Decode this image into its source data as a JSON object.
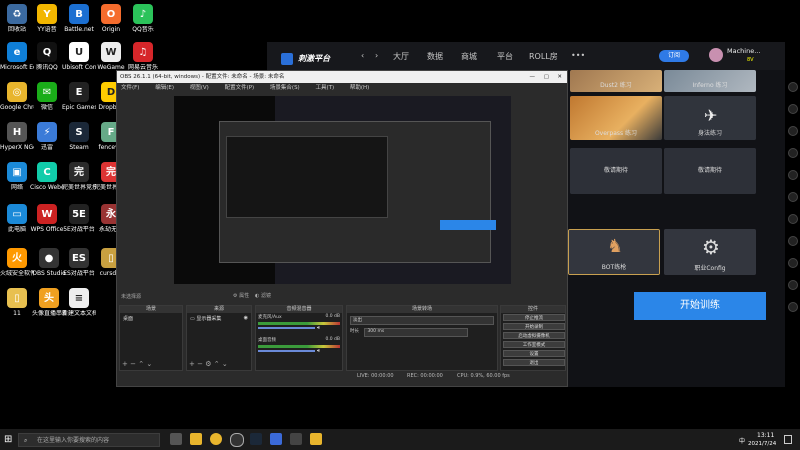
{
  "desktop": {
    "icons": [
      {
        "label": "回收站",
        "color": "#3b6aa0",
        "glyph": "♻"
      },
      {
        "label": "YY语音",
        "color": "#f2b600",
        "glyph": "Y"
      },
      {
        "label": "Battle.net",
        "color": "#1b6fd1",
        "glyph": "B"
      },
      {
        "label": "Origin",
        "color": "#f56c2d",
        "glyph": "O"
      },
      {
        "label": "QQ音乐",
        "color": "#2bc35a",
        "glyph": "♪"
      },
      {
        "label": "Microsoft Edge",
        "color": "#0f7fd8",
        "glyph": "e"
      },
      {
        "label": "腾讯QQ",
        "color": "#111",
        "glyph": "Q"
      },
      {
        "label": "Ubisoft Connect",
        "color": "#fff",
        "glyph": "U"
      },
      {
        "label": "WeGame",
        "color": "#eee",
        "glyph": "W"
      },
      {
        "label": "网易云音乐",
        "color": "#d6262a",
        "glyph": "♫"
      },
      {
        "label": "Google Chrome",
        "color": "#e8b52d",
        "glyph": "◎"
      },
      {
        "label": "微信",
        "color": "#1aad19",
        "glyph": "✉"
      },
      {
        "label": "Epic Games Launcher",
        "color": "#222",
        "glyph": "E"
      },
      {
        "label": "Dropbox",
        "color": "#ffcc00",
        "glyph": "D"
      },
      {
        "label": "HyperX NGenuity",
        "color": "#555",
        "glyph": "H"
      },
      {
        "label": "迅雷",
        "color": "#3b7bd8",
        "glyph": "⚡"
      },
      {
        "label": "Steam",
        "color": "#1b2838",
        "glyph": "S"
      },
      {
        "label": "fencevw",
        "color": "#6a8",
        "glyph": "F"
      },
      {
        "label": "网络",
        "color": "#1b8ad8",
        "glyph": "▣"
      },
      {
        "label": "Cisco Webex",
        "color": "#1ca",
        "glyph": "C"
      },
      {
        "label": "完美世界竞技平台",
        "color": "#2a2a2a",
        "glyph": "完"
      },
      {
        "label": "完美世界游戏平台",
        "color": "#d33",
        "glyph": "完"
      },
      {
        "label": "此电脑",
        "color": "#1b8ad8",
        "glyph": "▭"
      },
      {
        "label": "WPS Office",
        "color": "#c22",
        "glyph": "W"
      },
      {
        "label": "5E对战平台",
        "color": "#222",
        "glyph": "5E"
      },
      {
        "label": "永劫无间",
        "color": "#933",
        "glyph": "永"
      },
      {
        "label": "火绒安全软件",
        "color": "#f90",
        "glyph": "火"
      },
      {
        "label": "OBS Studio",
        "color": "#333",
        "glyph": "●"
      },
      {
        "label": "ES对战平台",
        "color": "#333",
        "glyph": "ES"
      },
      {
        "label": "cursdar",
        "color": "#c8a040",
        "glyph": "▯"
      },
      {
        "label": "11",
        "color": "#e8c050",
        "glyph": "▯"
      },
      {
        "label": "头像直播串流",
        "color": "#f0a020",
        "glyph": "头"
      },
      {
        "label": "新建文本文档.txt",
        "color": "#eee",
        "glyph": "≡"
      }
    ]
  },
  "perfectworld": {
    "logo": "刺激平台",
    "nav": [
      "大厅",
      "数据",
      "商城",
      "平台",
      "ROLL房",
      "•••"
    ],
    "vip_badge": "订阅",
    "user_name": "Machine...",
    "user_level": "8V",
    "cards": [
      {
        "label": "Dust2 练习"
      },
      {
        "label": "Inferno 练习"
      },
      {
        "label": "Overpass 练习"
      },
      {
        "label": "身法练习"
      },
      {
        "label": "敬请期待"
      },
      {
        "label": "敬请期待"
      },
      {
        "label": "BOT练枪"
      },
      {
        "label": "职业Config"
      }
    ],
    "start_button": "开始训练"
  },
  "obs": {
    "title": "OBS 26.1.1 (64-bit, windows) - 配置文件: 未命名 - 场景: 未命名",
    "menu": [
      "文件(F)",
      "编辑(E)",
      "视图(V)",
      "配置文件(P)",
      "场景集合(S)",
      "工具(T)",
      "帮助(H)"
    ],
    "source_label": "未选择源",
    "props_btn": "属性",
    "filters_btn": "滤镜",
    "docks": {
      "scenes": {
        "title": "场景",
        "item": "桌面"
      },
      "sources": {
        "title": "来源",
        "item": "显示器采集"
      },
      "mixer": {
        "title": "音频混音器",
        "ch1": "麦克风/Aux",
        "ch1_db": "0.0 dB",
        "ch2": "桌面音频",
        "ch2_db": "0.0 dB"
      },
      "transitions": {
        "title": "场景转场",
        "type": "淡出",
        "duration_label": "时长",
        "duration": "300 ms"
      },
      "controls": {
        "title": "控件",
        "buttons": [
          "停止推流",
          "开始录制",
          "启动虚拟摄像机",
          "工作室模式",
          "设置",
          "退出"
        ]
      }
    },
    "status": {
      "live": "LIVE: 00:00:00",
      "rec": "REC: 00:00:00",
      "cpu": "CPU: 0.9%, 60.00 fps"
    }
  },
  "taskbar": {
    "search_placeholder": "在这里输入你要搜索的内容",
    "lang": "中",
    "time": "13:11",
    "date": "2021/7/24"
  }
}
